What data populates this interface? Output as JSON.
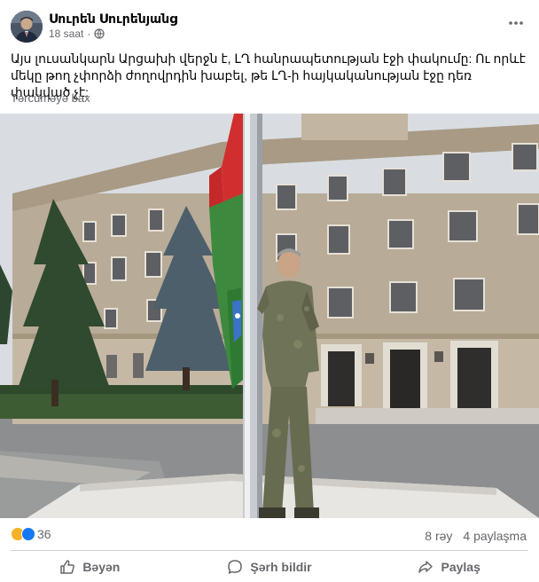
{
  "post": {
    "author": "Սուրեն Սուրենյանց",
    "time": "18 saat",
    "separator": "·",
    "text": "Այս լուսանկարն Արցախի վերջն է, ԼՂ հանրապետության էջի փակումը: Ու որևէ մեկը թող չփորձի ժողովրդին խաբել, թե ԼՂ-ի հայկականության էջը դեռ փակված չէ:",
    "translate_label": "Tərcüməyə bax"
  },
  "reactions": {
    "count": "36",
    "types": [
      "sad-reaction",
      "like-reaction"
    ],
    "colors": {
      "sad": "#f7b125",
      "like": "#1877f2"
    }
  },
  "stats": {
    "comments": "8 rəy",
    "shares": "4 paylaşma"
  },
  "actions": {
    "like": "Bəyən",
    "comment": "Şərh bildir",
    "share": "Paylaş"
  },
  "icons": {
    "more": "more-dots-icon",
    "globe": "globe-icon",
    "like": "thumbs-up-icon",
    "comment": "comment-bubble-icon",
    "share": "share-arrow-icon"
  }
}
